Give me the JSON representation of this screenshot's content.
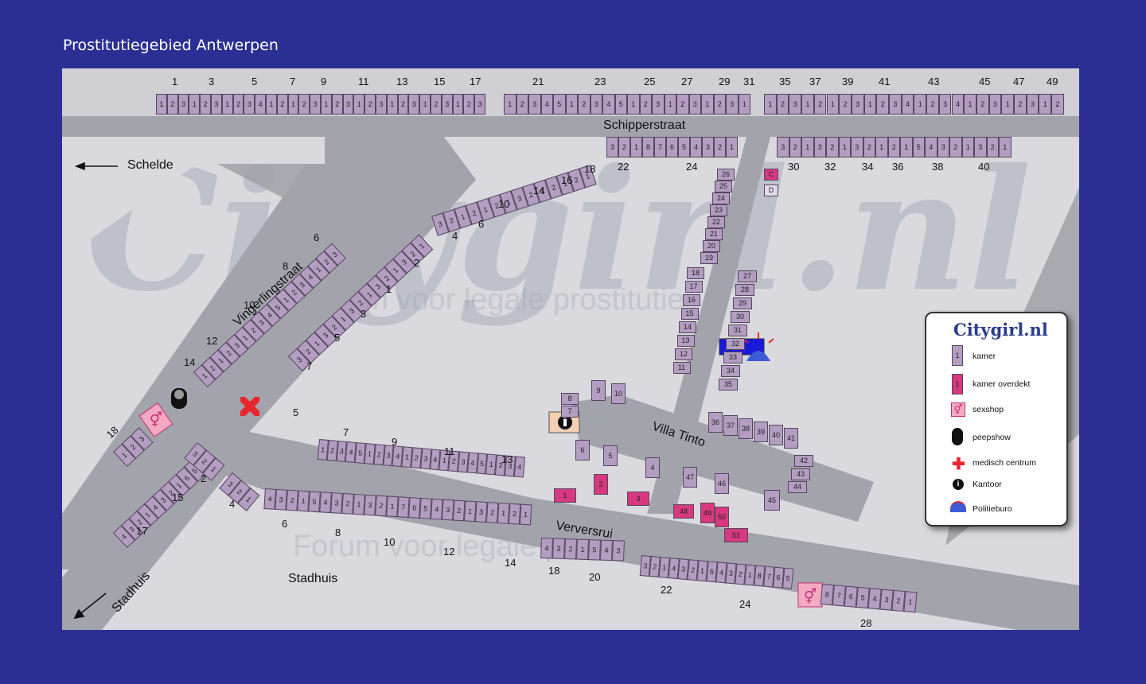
{
  "title": "Prostitutiegebied Antwerpen",
  "streets": {
    "schipperstraat": "Schipperstraat",
    "vingerlingstraat": "Vingerlingstraat",
    "villa_tinto": "Villa Tinto",
    "verversrui": "Verversrui",
    "stadhuis_road": "Stadhuis",
    "stadhuis_area": "Stadhuis",
    "schelde": "Schelde"
  },
  "watermark": {
    "logo": "Citygirl.nl",
    "slogan": "Forum voor legale prostitutie"
  },
  "top_row_numbers": [
    "1",
    "3",
    "5",
    "7",
    "9",
    "11",
    "13",
    "15",
    "17",
    "21",
    "23",
    "25",
    "27",
    "29",
    "31",
    "35",
    "37",
    "39",
    "41",
    "43",
    "45",
    "47",
    "49"
  ],
  "top_row_blocks": [
    [
      "1",
      "2",
      "3",
      "1",
      "2",
      "3",
      "1",
      "2",
      "3",
      "4",
      "1",
      "2",
      "1",
      "2",
      "3",
      "1",
      "2",
      "3",
      "1",
      "2",
      "3",
      "1",
      "2",
      "3",
      "1",
      "2",
      "3",
      "1",
      "2",
      "3"
    ],
    [
      "1",
      "2",
      "3",
      "4",
      "5",
      "1",
      "2",
      "3",
      "4",
      "5",
      "1",
      "2",
      "3",
      "1",
      "2",
      "3",
      "1",
      "2",
      "3",
      "1"
    ],
    [
      "1",
      "2",
      "3",
      "1",
      "2",
      "1",
      "2",
      "3",
      "1",
      "2",
      "3",
      "4",
      "1",
      "2",
      "3",
      "4",
      "1",
      "2",
      "3",
      "1",
      "2",
      "3",
      "1",
      "2"
    ]
  ],
  "schipper_north": {
    "left_rooms": [
      "3",
      "2",
      "1",
      "8",
      "7",
      "6",
      "5",
      "4",
      "3",
      "2",
      "1"
    ],
    "left_numbers": [
      "22",
      "24"
    ],
    "right_rooms": [
      "3",
      "2",
      "1",
      "3",
      "2",
      "1",
      "3",
      "2",
      "1",
      "2",
      "1",
      "5",
      "4",
      "3",
      "2",
      "1",
      "3",
      "2",
      "1"
    ],
    "right_numbers": [
      "30",
      "32",
      "34",
      "36",
      "38",
      "40"
    ],
    "pink_room": "C",
    "plain_room": "D"
  },
  "diag_top_rooms": [
    "3",
    "2",
    "1",
    "2",
    "1",
    "2",
    "1",
    "3",
    "2",
    "1",
    "2",
    "1",
    "2",
    "1"
  ],
  "diag_top_numbers": [
    "4",
    "6",
    "10",
    "14",
    "16",
    "18"
  ],
  "ving_upper_numbers": [
    "6",
    "8",
    "10",
    "12",
    "14"
  ],
  "ving_upper_rooms": [
    "1",
    "2",
    "1",
    "2",
    "3",
    "1",
    "2",
    "3",
    "4",
    "5",
    "1",
    "2",
    "3",
    "4",
    "1",
    "2",
    "3"
  ],
  "ving_lower_numbers": [
    "2",
    "1",
    "3",
    "5",
    "7"
  ],
  "ving_lower_rooms": [
    "3",
    "2",
    "1",
    "3",
    "2",
    "1",
    "3",
    "2",
    "1",
    "3",
    "2",
    "1",
    "3",
    "2",
    "1"
  ],
  "side_street_rooms": [
    "26",
    "25",
    "24",
    "23",
    "22",
    "21",
    "20",
    "19",
    "18",
    "17",
    "16",
    "15",
    "14",
    "13",
    "12",
    "11"
  ],
  "side_street_right_rooms": [
    "27",
    "28",
    "29",
    "30",
    "31",
    "32",
    "33",
    "34",
    "35"
  ],
  "villa_north_rooms": [
    "36",
    "37",
    "38",
    "39",
    "40",
    "41"
  ],
  "villa_east_rooms": [
    "42",
    "43",
    "44",
    "45"
  ],
  "villa_small_rooms": [
    "8",
    "7",
    "9",
    "10",
    "6",
    "5",
    "4",
    "47",
    "46"
  ],
  "pink_rooms": [
    "1",
    "2",
    "3",
    "48",
    "49",
    "50",
    "51"
  ],
  "left_lower": {
    "n18": "18",
    "rooms18": [
      "1",
      "2",
      "3"
    ],
    "n15": "15",
    "n17": "17",
    "rooms15": [
      "4",
      "3",
      "2",
      "1",
      "4",
      "3",
      "2",
      "1",
      "6",
      "5",
      "4"
    ],
    "n2": "2",
    "n4": "4",
    "rooms2": [
      "3",
      "2",
      "1",
      "3",
      "2",
      "1"
    ]
  },
  "verversrui_north_numbers": [
    "5",
    "7",
    "9",
    "11",
    "13"
  ],
  "verversrui_north_rooms": [
    "1",
    "2",
    "3",
    "4",
    "5",
    "1",
    "2",
    "3",
    "4",
    "1",
    "2",
    "3",
    "4",
    "1",
    "2",
    "3",
    "4",
    "5",
    "1",
    "2",
    "3",
    "4"
  ],
  "verversrui_south_numbers": [
    "6",
    "8",
    "10",
    "12",
    "14",
    "18",
    "20",
    "22",
    "24",
    "28"
  ],
  "verversrui_south_rooms": [
    "4",
    "3",
    "2",
    "1",
    "5",
    "4",
    "3",
    "2",
    "1",
    "3",
    "2",
    "1",
    "7",
    "6",
    "5",
    "4",
    "3",
    "2",
    "1",
    "3",
    "2",
    "1",
    "2",
    "1"
  ],
  "verversrui_se_rooms": [
    "3",
    "2",
    "1",
    "4",
    "3",
    "2",
    "1",
    "5",
    "4",
    "3",
    "2",
    "1",
    "8",
    "7",
    "6",
    "5",
    "4",
    "3",
    "2",
    "1",
    "8",
    "7",
    "6",
    "5",
    "4",
    "3",
    "2",
    "1"
  ],
  "legend": {
    "logo": "Citygirl.nl",
    "items": [
      {
        "sample": "1",
        "label": "kamer"
      },
      {
        "sample": "1",
        "label": "kamer overdekt"
      },
      {
        "icon": "sexshop-icon",
        "label": "sexshop"
      },
      {
        "icon": "peepshow-icon",
        "label": "peepshow"
      },
      {
        "icon": "medical-cross-icon",
        "label": "medisch centrum"
      },
      {
        "icon": "info-icon",
        "label": "Kantoor"
      },
      {
        "icon": "police-light-icon",
        "label": "Politieburo"
      }
    ]
  },
  "colors": {
    "background": "#2b2f94",
    "map": "#d9d9de",
    "road": "#a3a3ab",
    "room": "#b39ec2",
    "room_covered": "#d6397f",
    "police": "#1a1adb",
    "medical": "#e8262d"
  }
}
